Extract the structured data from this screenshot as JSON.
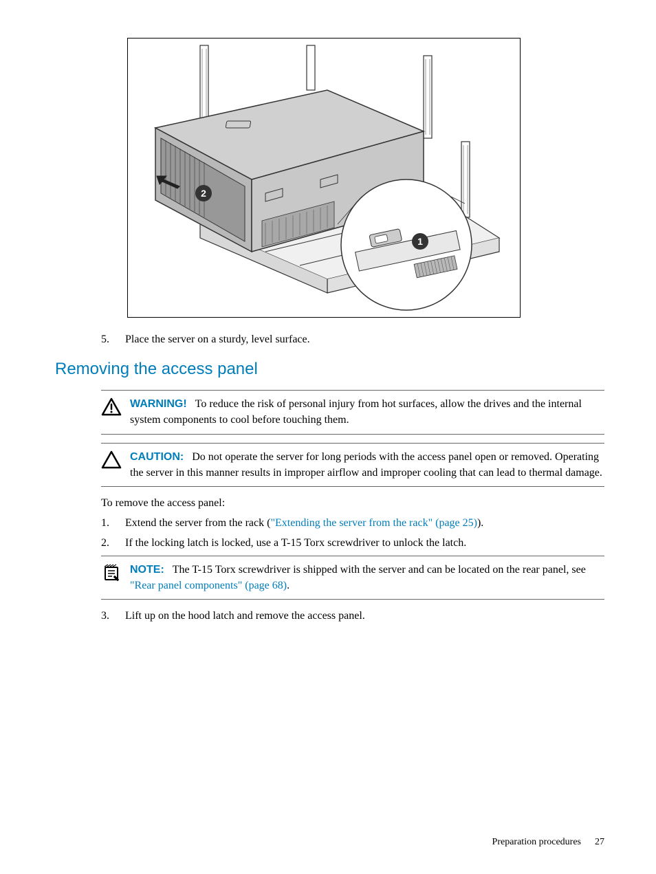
{
  "figure": {
    "callout1": "1",
    "callout2": "2"
  },
  "step5": {
    "num": "5.",
    "text": "Place the server on a sturdy, level surface."
  },
  "heading": "Removing the access panel",
  "warning": {
    "label": "WARNING!",
    "text": "To reduce the risk of personal injury from hot surfaces, allow the drives and the internal system components to cool before touching them."
  },
  "caution": {
    "label": "CAUTION:",
    "text": "Do not operate the server for long periods with the access panel open or removed. Operating the server in this manner results in improper airflow and improper cooling that can lead to thermal damage."
  },
  "intro": "To remove the access panel:",
  "step1": {
    "num": "1.",
    "before": "Extend the server from the rack (",
    "link": "\"Extending the server from the rack\" (page 25)",
    "after": ")."
  },
  "step2": {
    "num": "2.",
    "text": "If the locking latch is locked, use a T-15 Torx screwdriver to unlock the latch."
  },
  "note": {
    "label": "NOTE:",
    "before": "The T-15 Torx screwdriver is shipped with the server and can be located on the rear panel, see ",
    "link": "\"Rear panel components\" (page 68)",
    "after": "."
  },
  "step3": {
    "num": "3.",
    "text": "Lift up on the hood latch and remove the access panel."
  },
  "footer": {
    "section": "Preparation procedures",
    "page": "27"
  }
}
